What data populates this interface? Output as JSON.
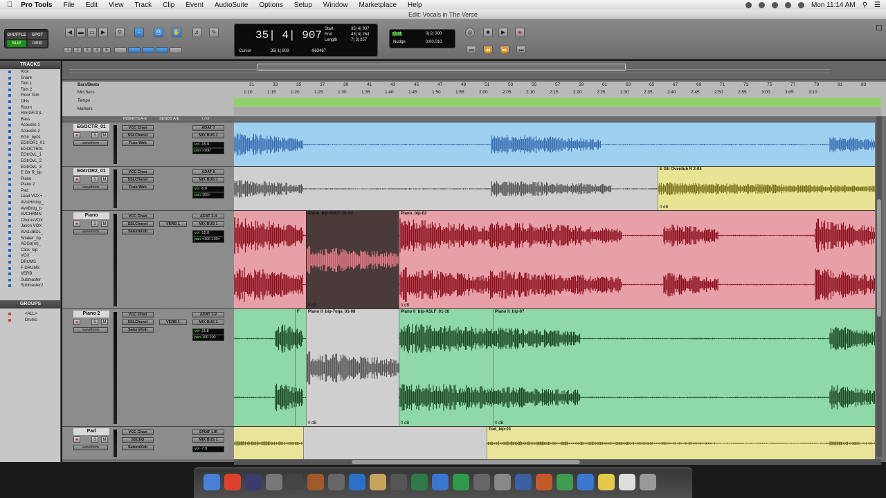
{
  "menubar": {
    "app": "Pro Tools",
    "items": [
      "File",
      "Edit",
      "View",
      "Track",
      "Clip",
      "Event",
      "AudioSuite",
      "Options",
      "Setup",
      "Window",
      "Marketplace",
      "Help"
    ],
    "clock": "Mon 11:14 AM"
  },
  "window_title": "Edit: Vocals in The Verse",
  "toolbar": {
    "modes": [
      "SHUFFLE",
      "SPOT",
      "SLIP",
      "GRID"
    ],
    "main_counter": "35| 4| 907",
    "start_label": "Start",
    "end_label": "End",
    "length_label": "Length",
    "start_val": "35| 4| 907",
    "end_val": "43| 4| 264",
    "length_val": "7| 3| 357",
    "cursor_label": "Cursor",
    "cursor_val": "35| 1| 809",
    "cursor_extra": "-963467",
    "grid_label": "Grid",
    "grid_val": "0| 2| 000",
    "nudge_label": "Nudge",
    "nudge_val": "0:00.010",
    "tracks_nums": [
      "1",
      "2",
      "3",
      "4",
      "5"
    ]
  },
  "tracks_panel": {
    "title": "TRACKS",
    "items": [
      "Kick",
      "Snare",
      "Tom 1",
      "Tom 2",
      "Floor Tom",
      "OHs",
      "Room",
      "Rm(GFIX)L",
      "Bass",
      "Acoustic 1",
      "Acoustic 2",
      "EGtr_bp01",
      "EGtrOR1_01",
      "EGOCTR01",
      "EGtrOvL_1",
      "EGtrOvL_2",
      "EGtrOvL_3",
      "E Gtr R_bp",
      "Piano",
      "Piano 2",
      "Pad",
      "Lead VOX+",
      "AVs/Hmmy_",
      "AVxBrdg_b",
      "AVCHRMN",
      "ChorusVOX",
      "Jaxon VOX",
      "AVsLdBDL_",
      "Shaker_bp",
      "ADGtr(m)_",
      "Click_bip",
      "VOX",
      "DRUMS",
      "F DRUMS",
      "VERB",
      "Submaster",
      "Submaster2"
    ],
    "groups_title": "GROUPS",
    "groups": [
      "<ALL>",
      "Drums"
    ]
  },
  "rulers": {
    "labels": [
      "Bars/Beats",
      "Min:Secs",
      "Tempo",
      "Markers"
    ],
    "bars": [
      "31",
      "33",
      "35",
      "37",
      "39",
      "41",
      "43",
      "45",
      "47",
      "49",
      "51",
      "53",
      "55",
      "57",
      "59",
      "61",
      "63",
      "65",
      "67",
      "69",
      "71",
      "73",
      "75",
      "77",
      "79",
      "81",
      "83"
    ],
    "mins": [
      "1:10",
      "1:15",
      "1:20",
      "1:25",
      "1:30",
      "1:35",
      "1:40",
      "1:45",
      "1:50",
      "1:55",
      "2:00",
      "2:05",
      "2:10",
      "2:15",
      "2:20",
      "2:25",
      "2:30",
      "2:35",
      "2:40",
      "2:45",
      "2:50",
      "2:55",
      "3:00",
      "3:05",
      "3:10"
    ]
  },
  "header_labels": {
    "inserts": "INSERTS A-E",
    "sends": "SENDS A-E",
    "io": "I / O"
  },
  "tracks": [
    {
      "name": "EGOCTR_01",
      "inserts": [
        "VCC Chan",
        "SSLChanel",
        "Fuzz-Wah"
      ],
      "send": "",
      "input": "ADAT 7",
      "output": "MIX BUS 1",
      "vol": "-15.0",
      "pan": ">100",
      "view": "waveform",
      "color": "#9fd0ef",
      "wave": "#3b6fb3"
    },
    {
      "name": "EGtrOR2_01",
      "inserts": [
        "VCC Chan",
        "SSLChanel",
        "Fuzz-Wah"
      ],
      "send": "",
      "input": "ADAT 8",
      "output": "MIX BUS 1",
      "vol": "-6.8",
      "pan": "100>",
      "view": "waveform",
      "color": "#cfcfcf",
      "wave": "#555555"
    },
    {
      "name": "Piano",
      "inserts": [
        "VCC Chan",
        "SSLChanel",
        "SaturnKnb"
      ],
      "send": "VERB 1",
      "input": "ADAT 3-4",
      "output": "MIX BUS 1",
      "vol": "-12.0",
      "pan": "<100 100>",
      "view": "waveform",
      "color": "#e8a0a8",
      "wave": "#8b0f1c"
    },
    {
      "name": "Piano 2",
      "inserts": [
        "VCC Chan",
        "SSLChanel",
        "SaturnKnb"
      ],
      "send": "VERB 1",
      "input": "ADAT 1-2",
      "output": "MIX BUS 1",
      "vol": "-11.8",
      "pan": "100 100",
      "view": "waveform",
      "color": "#8fd8a8",
      "wave": "#1d4a24"
    },
    {
      "name": "Pad",
      "inserts": [
        "VCC Chan",
        "SSLEQ",
        "SaturnKnb"
      ],
      "send": "",
      "input": "SPDIF L/R",
      "output": "MIX BUS 1",
      "vol": "-7.0",
      "pan": "",
      "view": "waveform",
      "color": "#e9e49a",
      "wave": "#6b6420"
    }
  ],
  "regions": {
    "egtr_ovr": "E Gtr Overdub R 2-04",
    "piano_1": "Piano_bip-ASLF_01-02",
    "piano_2": "Piano_bip-02",
    "piano2_1": "Piano II_bip-7oqa_01-08",
    "piano2_2": "Piano II_bip-ASLF_01-10",
    "piano2_3": "Piano II_bip-07",
    "pad_1": "Pad_bip-03",
    "gain": "0 dB",
    "f": "F"
  },
  "dock": [
    "Finder",
    "Chrome",
    "Pro Tools",
    "Mail",
    "Photo",
    "Utility",
    "Grid",
    "iTunes",
    "Preview",
    "Tools",
    "Sync",
    "Safari",
    "Drive",
    "Calc",
    "Preferences",
    "Xcode",
    "Folder",
    "Numbers",
    "Safari",
    "Stickies",
    "Files",
    "Trash"
  ]
}
